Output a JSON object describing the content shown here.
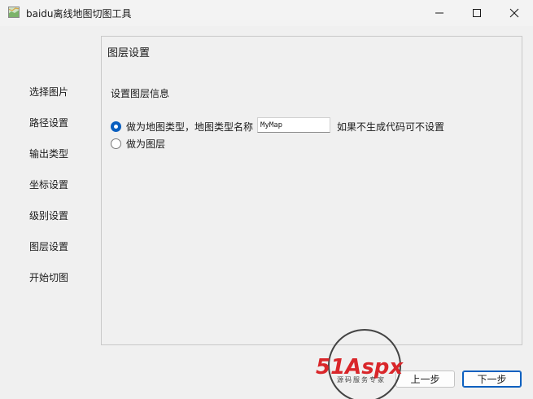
{
  "window": {
    "title": "baidu离线地图切图工具"
  },
  "sidebar": {
    "items": [
      {
        "label": "选择图片"
      },
      {
        "label": "路径设置"
      },
      {
        "label": "输出类型"
      },
      {
        "label": "坐标设置"
      },
      {
        "label": "级别设置"
      },
      {
        "label": "图层设置"
      },
      {
        "label": "开始切图"
      }
    ]
  },
  "panel": {
    "title": "图层设置",
    "section_label": "设置图层信息",
    "option_map_type": {
      "label": "做为地图类型，地图类型名称",
      "checked": true
    },
    "map_name_value": "MyMap",
    "hint": "如果不生成代码可不设置",
    "option_layer": {
      "label": "做为图层",
      "checked": false
    }
  },
  "buttons": {
    "prev": "上一步",
    "next": "下一步"
  },
  "watermark": {
    "brand": "51Aspx",
    "tagline": "源码服务专家"
  },
  "colors": {
    "accent": "#0a5fbf",
    "watermark_red": "#d9262a",
    "watermark_green": "#4caf50"
  }
}
